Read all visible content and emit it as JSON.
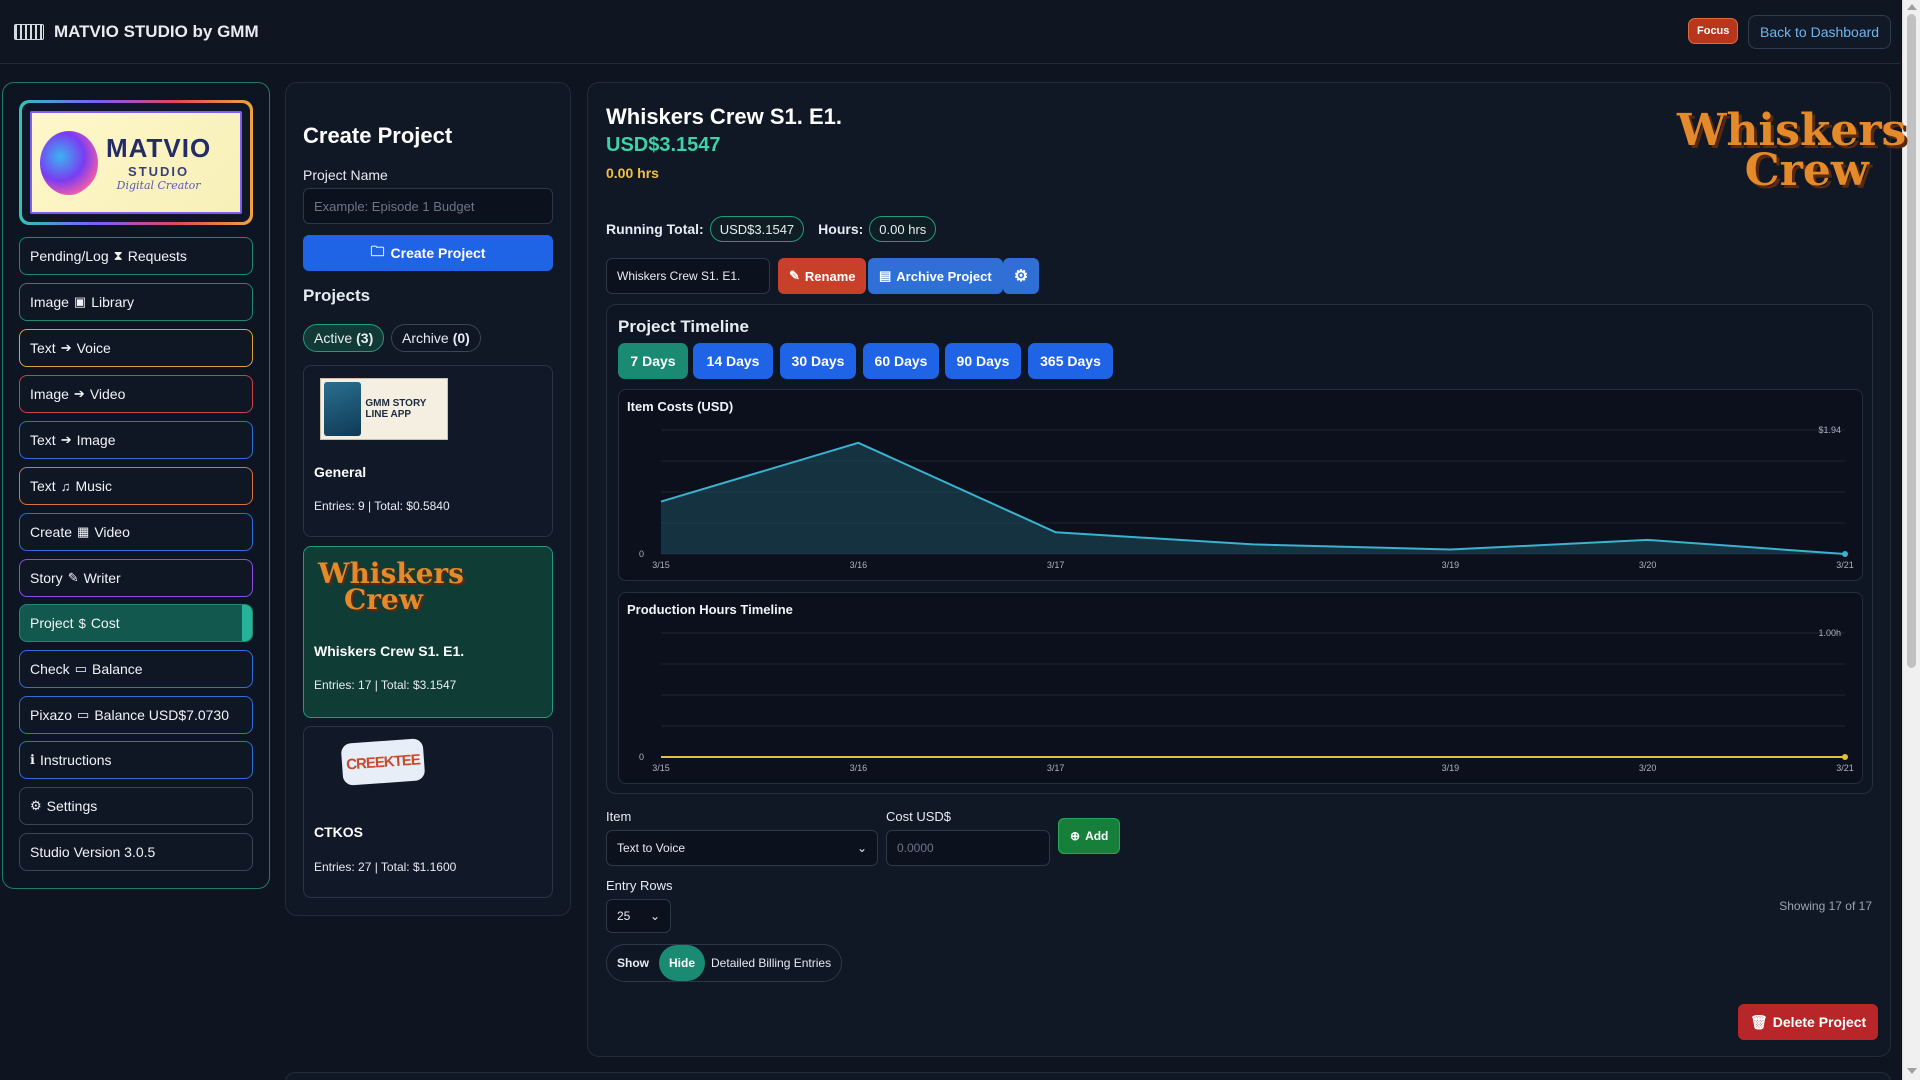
{
  "app": {
    "title": "MATVIO STUDIO by GMM",
    "focus_label": "Focus",
    "back_label": "Back to Dashboard"
  },
  "logo": {
    "line1": "MATVIO",
    "line2": "STUDIO",
    "line3": "Digital Creator"
  },
  "sidebar": {
    "items": [
      {
        "label_a": "Pending/Log",
        "icon": "hourglass-icon",
        "glyph": "⧗",
        "label_b": "Requests",
        "color": "#1f8a70"
      },
      {
        "label_a": "Image",
        "icon": "image-icon",
        "glyph": "▣",
        "label_b": "Library",
        "color": "#1f8a70"
      },
      {
        "label_a": "Text",
        "icon": "arrow-circle-icon",
        "glyph": "➔",
        "label_b": "Voice",
        "color": "#d9a33a"
      },
      {
        "label_a": "Image",
        "icon": "arrow-circle-icon",
        "glyph": "➔",
        "label_b": "Video",
        "color": "#c8404a"
      },
      {
        "label_a": "Text",
        "icon": "arrow-circle-icon",
        "glyph": "➔",
        "label_b": "Image",
        "color": "#2f6fd6"
      },
      {
        "label_a": "Text",
        "icon": "music-list-icon",
        "glyph": "♫",
        "label_b": "Music",
        "color": "#d9733a"
      },
      {
        "label_a": "Create",
        "icon": "film-icon",
        "glyph": "▦",
        "label_b": "Video",
        "color": "#2f6fd6"
      },
      {
        "label_a": "Story",
        "icon": "edit-icon",
        "glyph": "✎",
        "label_b": "Writer",
        "color": "#8a4fe0"
      },
      {
        "label_a": "Project",
        "icon": "dollar-icon",
        "glyph": "$",
        "label_b": "Cost",
        "color": "#1f8a70"
      },
      {
        "label_a": "Check",
        "icon": "wallet-icon",
        "glyph": "▭",
        "label_b": "Balance",
        "color": "#2f6fd6"
      },
      {
        "label_a": "Pixazo",
        "icon": "wallet-icon",
        "glyph": "▭",
        "label_b": "Balance USD$7.0730",
        "color": "#2f6fd6"
      },
      {
        "label_a": "",
        "icon": "info-icon",
        "glyph": "ℹ",
        "label_b": "Instructions",
        "color": "#2f6fd6"
      },
      {
        "label_a": "",
        "icon": "gear-icon",
        "glyph": "⚙",
        "label_b": "Settings",
        "color": "#3a4556"
      },
      {
        "label_a": "",
        "icon": "",
        "glyph": "",
        "label_b": "Studio Version 3.0.5",
        "color": "#3a4556"
      }
    ]
  },
  "create": {
    "title": "Create Project",
    "name_label": "Project Name",
    "name_placeholder": "Example: Episode 1 Budget",
    "button": "Create Project"
  },
  "projects": {
    "title": "Projects",
    "tab_active": "Active",
    "tab_active_count": "(3)",
    "tab_archive": "Archive",
    "tab_archive_count": "(0)",
    "list": [
      {
        "name": "General",
        "meta": "Entries: 9 | Total: $0.5840",
        "thumb_text": "GMM STORY LINE APP"
      },
      {
        "name": "Whiskers Crew S1. E1.",
        "meta": "Entries: 17 | Total: $3.1547",
        "thumb_text": "Whiskers Crew"
      },
      {
        "name": "CTKOS",
        "meta": "Entries: 27 | Total: $1.1600",
        "thumb_text": "CREEKTEE"
      }
    ]
  },
  "detail": {
    "title": "Whiskers Crew S1. E1.",
    "cost": "USD$3.1547",
    "hours": "0.00 hrs",
    "running_label": "Running Total:",
    "running_value": "USD$3.1547",
    "hours_label": "Hours:",
    "hours_value": "0.00 hrs",
    "name_value": "Whiskers Crew S1. E1.",
    "rename": "Rename",
    "archive": "Archive Project",
    "logo_line1": "Whiskers",
    "logo_line2": "Crew"
  },
  "timeline": {
    "title": "Project Timeline",
    "ranges": [
      "7 Days",
      "14 Days",
      "30 Days",
      "60 Days",
      "90 Days",
      "365 Days"
    ]
  },
  "chart_data": [
    {
      "type": "area",
      "title": "Item Costs (USD)",
      "x": [
        "3/15",
        "3/16",
        "3/17",
        "3/18",
        "3/19",
        "3/20",
        "3/21"
      ],
      "x_ticks": [
        "3/15",
        "3/16",
        "3/17",
        "3/19",
        "3/20",
        "3/21"
      ],
      "values": [
        0.82,
        1.74,
        0.34,
        0.15,
        0.07,
        0.22,
        0.0
      ],
      "ylim": [
        0,
        1.94
      ],
      "y_ticks": [
        "0",
        "$1.94"
      ],
      "color": "#3ab2d0"
    },
    {
      "type": "line",
      "title": "Production Hours Timeline",
      "x": [
        "3/15",
        "3/16",
        "3/17",
        "3/18",
        "3/19",
        "3/20",
        "3/21"
      ],
      "x_ticks": [
        "3/15",
        "3/16",
        "3/17",
        "3/19",
        "3/20",
        "3/21"
      ],
      "values": [
        0,
        0,
        0,
        0,
        0,
        0,
        0
      ],
      "ylim": [
        0,
        1.0
      ],
      "y_ticks": [
        "0",
        "1.00h"
      ],
      "color": "#e0c23a"
    }
  ],
  "entry": {
    "item_label": "Item",
    "item_value": "Text to Voice",
    "cost_label": "Cost USD$",
    "cost_placeholder": "0.0000",
    "add": "Add",
    "rows_label": "Entry Rows",
    "rows_value": "25",
    "showing": "Showing 17 of 17",
    "show": "Show",
    "hide": "Hide",
    "billing": "Detailed Billing Entries",
    "delete": "Delete Project"
  }
}
